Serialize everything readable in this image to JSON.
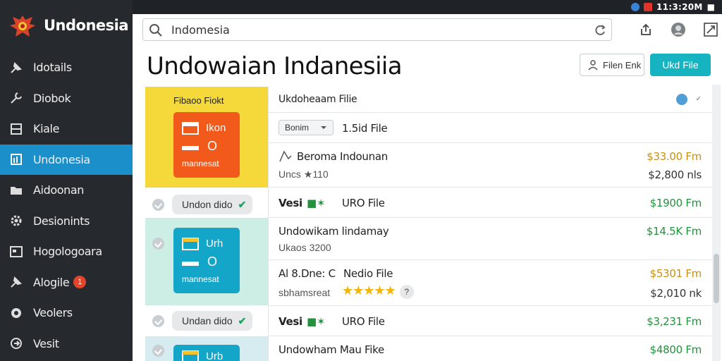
{
  "tray": {
    "time": "11:3:20M"
  },
  "brand": {
    "name": "Undonesia"
  },
  "sidebar": {
    "items": [
      {
        "label": "Idotails",
        "icon": "pin-icon"
      },
      {
        "label": "Diobok",
        "icon": "wrench-icon"
      },
      {
        "label": "Kiale",
        "icon": "grid-icon"
      },
      {
        "label": "Undonesia",
        "icon": "chart-icon",
        "active": true
      },
      {
        "label": "Aidoonan",
        "icon": "folder-icon"
      },
      {
        "label": "Desionints",
        "icon": "gear-icon"
      },
      {
        "label": "Hogologoara",
        "icon": "image-icon"
      },
      {
        "label": "Alogile",
        "icon": "pin-icon",
        "badge": "1"
      },
      {
        "label": "Veolers",
        "icon": "globe-icon"
      },
      {
        "label": "Vesit",
        "icon": "export-icon"
      }
    ]
  },
  "search": {
    "value": "Indomesia"
  },
  "page": {
    "title": "Undowaian Indanesiia"
  },
  "actions": {
    "filter_label": "Filen Enk",
    "upload_label": "Ukd File"
  },
  "tiles": {
    "caption": "Fibaoo Fiokt",
    "orange_card": {
      "t1": "Ikon",
      "t2": "O",
      "t3": "mannesat"
    },
    "teal_card": {
      "t1": "Urh",
      "t2": "O",
      "t3": "mannesat"
    },
    "teal3_card": {
      "t1": "Urb"
    },
    "pill1": {
      "label": "Undon dido"
    },
    "pill2": {
      "label": "Undan dido"
    }
  },
  "rows": {
    "header": {
      "title": "Ukdoheaam Filie"
    },
    "select": {
      "value": "Bonim",
      "after": "1.5id File"
    },
    "r1": {
      "title": "Beroma  Indounan",
      "sub": "Uncs ★110",
      "price1": "$33.00 Fm",
      "price2": "$2,800 nls"
    },
    "r2": {
      "tag": "Vesi",
      "icons": "■✶",
      "label": "URO File",
      "price": "$1900 Fm"
    },
    "r3": {
      "title": "Undowikam lindamay",
      "sub": "Ukaos 3200",
      "price": "$14.5K Fm"
    },
    "r4": {
      "tag": "Al 8.Dne: C",
      "label": "Nedio File",
      "sub": "sbhamsreat",
      "q": "?",
      "price1": "$5301 Fm",
      "price2": "$2,010 nk"
    },
    "r5": {
      "tag": "Vesi",
      "icons": "■✶",
      "label": "URO File",
      "price": "$3,231 Fm"
    },
    "r6": {
      "title": "Undowham  Mau Fike",
      "price": "$4800 Fm"
    }
  },
  "colors": {
    "accent": "#1b8fc9",
    "upload": "#16b4c1",
    "sidebar": "#262a2e",
    "tile_yellow": "#f5d93a",
    "card_orange": "#f25a1c",
    "card_teal": "#14a6c8"
  }
}
